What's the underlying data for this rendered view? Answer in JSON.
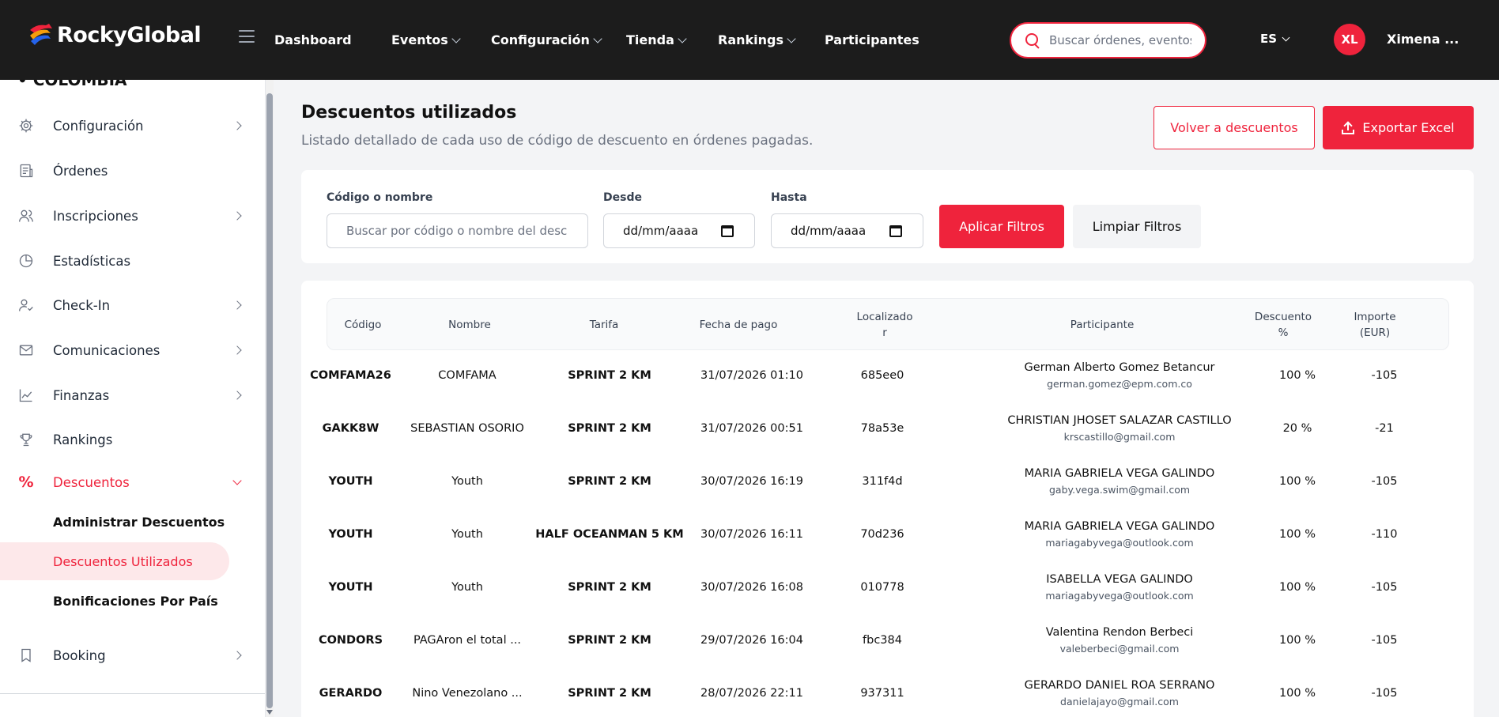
{
  "header": {
    "brand": "RockyGlobal",
    "nav": [
      {
        "label": "Dashboard",
        "has_menu": false
      },
      {
        "label": "Eventos",
        "has_menu": true
      },
      {
        "label": "Configuración",
        "has_menu": true
      },
      {
        "label": "Tienda",
        "has_menu": true
      },
      {
        "label": "Rankings",
        "has_menu": true
      },
      {
        "label": "Participantes",
        "has_menu": false
      }
    ],
    "search_placeholder": "Buscar órdenes, eventos",
    "language": "ES",
    "avatar_initials": "XL",
    "user_name": "Ximena ..."
  },
  "sidebar": {
    "country": "• COLOMBIA",
    "items": [
      {
        "label": "Configuración",
        "icon": "gear-icon",
        "chevron": true
      },
      {
        "label": "Órdenes",
        "icon": "receipt-icon",
        "chevron": false
      },
      {
        "label": "Inscripciones",
        "icon": "users-icon",
        "chevron": true
      },
      {
        "label": "Estadísticas",
        "icon": "pie-chart-icon",
        "chevron": false
      },
      {
        "label": "Check-In",
        "icon": "user-check-icon",
        "chevron": true
      },
      {
        "label": "Comunicaciones",
        "icon": "mail-icon",
        "chevron": true
      },
      {
        "label": "Finanzas",
        "icon": "trend-icon",
        "chevron": true
      },
      {
        "label": "Rankings",
        "icon": "trophy-icon",
        "chevron": false
      },
      {
        "label": "Descuentos",
        "icon": "percent-icon",
        "chevron": true,
        "active": true
      }
    ],
    "subitems": [
      {
        "label": "Administrar Descuentos",
        "active": false
      },
      {
        "label": "Descuentos Utilizados",
        "active": true
      },
      {
        "label": "Bonificaciones Por País",
        "active": false
      }
    ],
    "booking": {
      "label": "Booking",
      "icon": "bookmark-icon"
    }
  },
  "page": {
    "title": "Descuentos utilizados",
    "subtitle": "Listado detallado de cada uso de código de descuento en órdenes pagadas.",
    "back_button": "Volver a descuentos",
    "export_button": "Exportar Excel"
  },
  "filters": {
    "code_label": "Código o nombre",
    "code_placeholder": "Buscar por código o nombre del desc",
    "from_label": "Desde",
    "from_value": "dd/mm/aaaa",
    "to_label": "Hasta",
    "to_value": "dd/mm/aaaa",
    "apply_button": "Aplicar Filtros",
    "clear_button": "Limpiar Filtros"
  },
  "table": {
    "columns": [
      "Código",
      "Nombre",
      "Tarifa",
      "Fecha de pago",
      "Localizado r",
      "Participante",
      "Descuento %",
      "Importe (EUR)"
    ],
    "rows": [
      {
        "code": "COMFAMA26",
        "name": "COMFAMA",
        "tariff": "SPRINT 2 KM",
        "date": "31/07/2026 01:10",
        "locator": "685ee0",
        "participant": "German Alberto Gomez Betancur",
        "email": "german.gomez@epm.com.co",
        "discount": "100 %",
        "amount": "-105"
      },
      {
        "code": "GAKK8W",
        "name": "SEBASTIAN OSORIO",
        "tariff": "SPRINT 2 KM",
        "date": "31/07/2026 00:51",
        "locator": "78a53e",
        "participant": "CHRISTIAN JHOSET SALAZAR CASTILLO",
        "email": "krscastillo@gmail.com",
        "discount": "20 %",
        "amount": "-21"
      },
      {
        "code": "YOUTH",
        "name": "Youth",
        "tariff": "SPRINT 2 KM",
        "date": "30/07/2026 16:19",
        "locator": "311f4d",
        "participant": "MARIA GABRIELA VEGA GALINDO",
        "email": "gaby.vega.swim@gmail.com",
        "discount": "100 %",
        "amount": "-105"
      },
      {
        "code": "YOUTH",
        "name": "Youth",
        "tariff": "HALF OCEANMAN 5 KM",
        "date": "30/07/2026 16:11",
        "locator": "70d236",
        "participant": "MARIA GABRIELA VEGA GALINDO",
        "email": "mariagabyvega@outlook.com",
        "discount": "100 %",
        "amount": "-110"
      },
      {
        "code": "YOUTH",
        "name": "Youth",
        "tariff": "SPRINT 2 KM",
        "date": "30/07/2026 16:08",
        "locator": "010778",
        "participant": "ISABELLA VEGA GALINDO",
        "email": "mariagabyvega@outlook.com",
        "discount": "100 %",
        "amount": "-105"
      },
      {
        "code": "CONDORS",
        "name": "PAGAron el total ...",
        "tariff": "SPRINT 2 KM",
        "date": "29/07/2026 16:04",
        "locator": "fbc384",
        "participant": "Valentina Rendon Berbeci",
        "email": "valeberbeci@gmail.com",
        "discount": "100 %",
        "amount": "-105"
      },
      {
        "code": "GERARDO",
        "name": "Nino Venezolano ...",
        "tariff": "SPRINT 2 KM",
        "date": "28/07/2026 22:11",
        "locator": "937311",
        "participant": "GERARDO DANIEL ROA SERRANO",
        "email": "danielajayo@gmail.com",
        "discount": "100 %",
        "amount": "-105"
      }
    ]
  },
  "colors": {
    "accent": "#ef233c",
    "topbar": "#1c1c1c",
    "background": "#f3f4f6"
  }
}
